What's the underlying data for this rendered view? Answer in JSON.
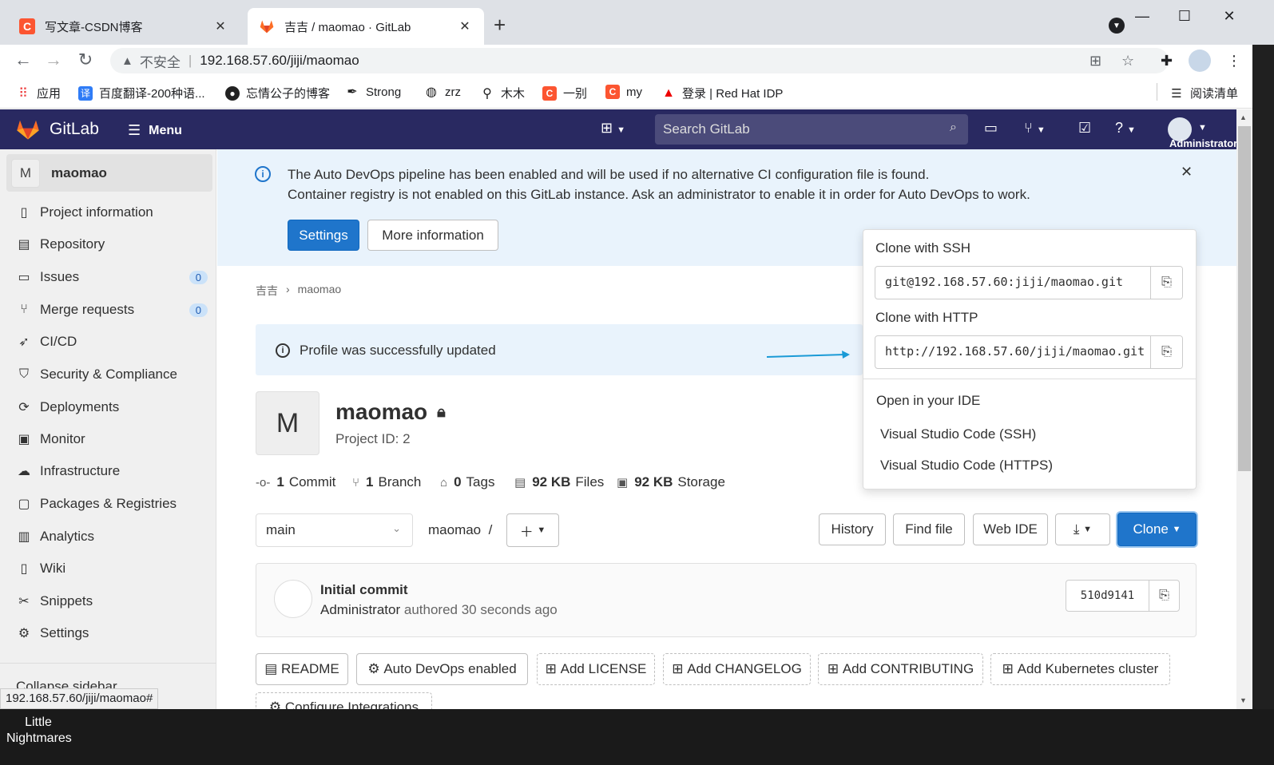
{
  "browser": {
    "tabs": [
      {
        "title": "写文章-CSDN博客",
        "icon": "csdn-icon",
        "active": false
      },
      {
        "title": "吉吉 / maomao · GitLab",
        "icon": "gitlab-icon",
        "active": true
      }
    ],
    "insecure_label": "不安全",
    "url": "192.168.57.60/jiji/maomao",
    "bookmarks": [
      {
        "label": "应用",
        "icon": "apps-grid-icon"
      },
      {
        "label": "百度翻译-200种语...",
        "icon": "baidu-translate-icon"
      },
      {
        "label": "忘情公子的博客",
        "icon": "github-icon"
      },
      {
        "label": "Strong",
        "icon": "feather-icon"
      },
      {
        "label": "zrz",
        "icon": "globe-icon"
      },
      {
        "label": "木木",
        "icon": "figure-icon"
      },
      {
        "label": "一别",
        "icon": "csdn-icon"
      },
      {
        "label": "my",
        "icon": "csdn-icon"
      },
      {
        "label": "登录 | Red Hat IDP",
        "icon": "redhat-icon"
      }
    ],
    "reading_list": "阅读清单",
    "status_url": "192.168.57.60/jiji/maomao#"
  },
  "header": {
    "brand": "GitLab",
    "menu": "Menu",
    "search_placeholder": "Search GitLab",
    "user": "Administrator"
  },
  "sidebar": {
    "project_initial": "M",
    "project_name": "maomao",
    "items": [
      {
        "label": "Project information",
        "icon": "info-book-icon"
      },
      {
        "label": "Repository",
        "icon": "doc-icon"
      },
      {
        "label": "Issues",
        "icon": "issues-icon",
        "count": "0"
      },
      {
        "label": "Merge requests",
        "icon": "merge-icon",
        "count": "0"
      },
      {
        "label": "CI/CD",
        "icon": "rocket-icon"
      },
      {
        "label": "Security & Compliance",
        "icon": "shield-icon"
      },
      {
        "label": "Deployments",
        "icon": "deploy-icon"
      },
      {
        "label": "Monitor",
        "icon": "monitor-icon"
      },
      {
        "label": "Infrastructure",
        "icon": "cloud-icon"
      },
      {
        "label": "Packages & Registries",
        "icon": "package-icon"
      },
      {
        "label": "Analytics",
        "icon": "chart-icon"
      },
      {
        "label": "Wiki",
        "icon": "book-icon"
      },
      {
        "label": "Snippets",
        "icon": "scissors-icon"
      },
      {
        "label": "Settings",
        "icon": "gear-icon"
      }
    ],
    "collapse": "Collapse sidebar"
  },
  "alert": {
    "line1": "The Auto DevOps pipeline has been enabled and will be used if no alternative CI configuration file is found.",
    "line2": "Container registry is not enabled on this GitLab instance. Ask an administrator to enable it in order for Auto DevOps to work.",
    "settings_btn": "Settings",
    "more_btn": "More information"
  },
  "breadcrumb": {
    "group": "吉吉",
    "project": "maomao"
  },
  "flash": "Profile was successfully updated",
  "project": {
    "initial": "M",
    "name": "maomao",
    "id_label": "Project ID: 2",
    "stats": {
      "commits_n": "1",
      "commits": "Commit",
      "branches_n": "1",
      "branches": "Branch",
      "tags_n": "0",
      "tags": "Tags",
      "files_n": "92 KB",
      "files": "Files",
      "storage_n": "92 KB",
      "storage": "Storage"
    }
  },
  "repo": {
    "branch": "main",
    "path": "maomao",
    "path_sep": "/",
    "history": "History",
    "find_file": "Find file",
    "web_ide": "Web IDE",
    "clone": "Clone"
  },
  "commit": {
    "title": "Initial commit",
    "author": "Administrator",
    "authored": "authored 30 seconds ago",
    "sha": "510d9141"
  },
  "clone_dropdown": {
    "ssh_label": "Clone with SSH",
    "ssh_url": "git@192.168.57.60:jiji/maomao.git",
    "http_label": "Clone with HTTP",
    "http_url": "http://192.168.57.60/jiji/maomao.git",
    "ide_label": "Open in your IDE",
    "ide_ssh": "Visual Studio Code (SSH)",
    "ide_https": "Visual Studio Code (HTTPS)"
  },
  "quick_actions": {
    "readme": "README",
    "autodevops": "Auto DevOps enabled",
    "license": "Add LICENSE",
    "changelog": "Add CHANGELOG",
    "contributing": "Add CONTRIBUTING",
    "k8s": "Add Kubernetes cluster",
    "integrations": "Configure Integrations"
  },
  "taskbar": {
    "label": "Little Nightmares"
  }
}
